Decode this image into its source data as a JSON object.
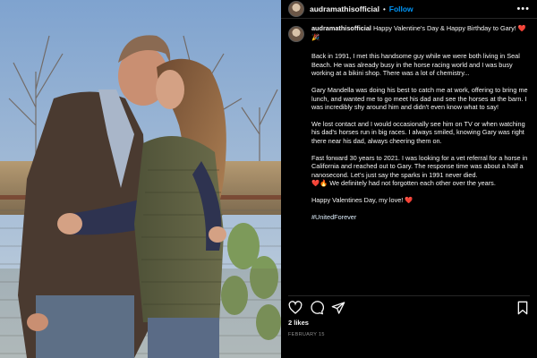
{
  "post": {
    "username": "audramathisofficial",
    "follow_label": "Follow",
    "separator": "•",
    "more_label": "•••",
    "caption_user": "audramathisofficial",
    "caption_intro": "Happy Valentine's Day & Happy Birthday to Gary!",
    "caption_intro_emoji": "❤️🎉",
    "paragraphs": [
      "Back in 1991, I met this handsome guy while we were both living in Seal Beach. He was already busy in the horse racing world and I was busy working at a bikini shop. There was a lot of chemistry...",
      "Gary Mandella was doing his best to catch me at work, offering to bring me lunch, and wanted me to go meet his dad and see the horses at the barn. I was incredibly shy around him and didn't even know what to say!",
      "We lost contact and I would occasionally see him on TV or when watching his dad's horses run in big races. I always smiled, knowing Gary was right there near his dad, always cheering them on.",
      "Fast forward 30 years to 2021. I was looking for a vet referral for a horse in California and reached out to Gary. The response time was about a half a nanosecond. Let's just say the sparks in 1991 never died.",
      "We definitely had not forgotten each other over the years."
    ],
    "p5_emoji": "❤️🔥",
    "closing": "Happy Valentines Day, my love!",
    "closing_emoji": "❤️",
    "hashtag": "#UnitedForever",
    "likes": "2 likes",
    "date": "FEBRUARY 15"
  },
  "icons": {
    "like": "heart-icon",
    "comment": "comment-icon",
    "share": "share-icon",
    "save": "bookmark-icon",
    "more": "more-icon"
  },
  "colors": {
    "background": "#000000",
    "text": "#f5f5f5",
    "follow": "#0095f6",
    "muted": "#8e8e8e",
    "heart": "#ed2e43"
  }
}
